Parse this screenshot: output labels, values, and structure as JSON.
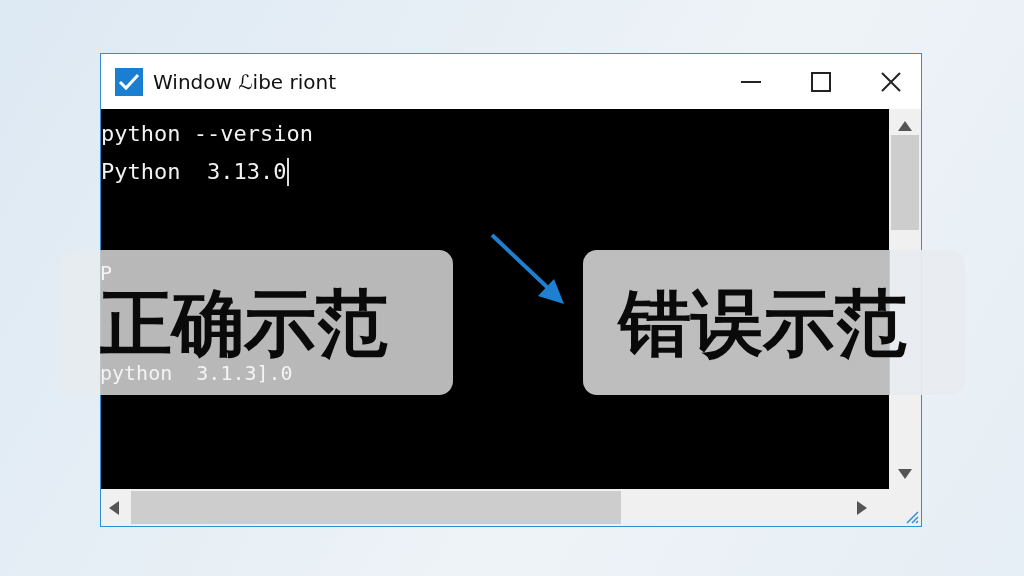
{
  "window": {
    "title": "Window ℒibe riont",
    "checked": true
  },
  "terminal": {
    "lines": [
      "python --version",
      "Python  3.13.0"
    ]
  },
  "overlays": [
    {
      "kind": "correct",
      "label": "正确示范",
      "ghost_lines": [
        "P",
        "python  3.1.3].0"
      ]
    },
    {
      "kind": "wrong",
      "label": "错误示范"
    }
  ]
}
